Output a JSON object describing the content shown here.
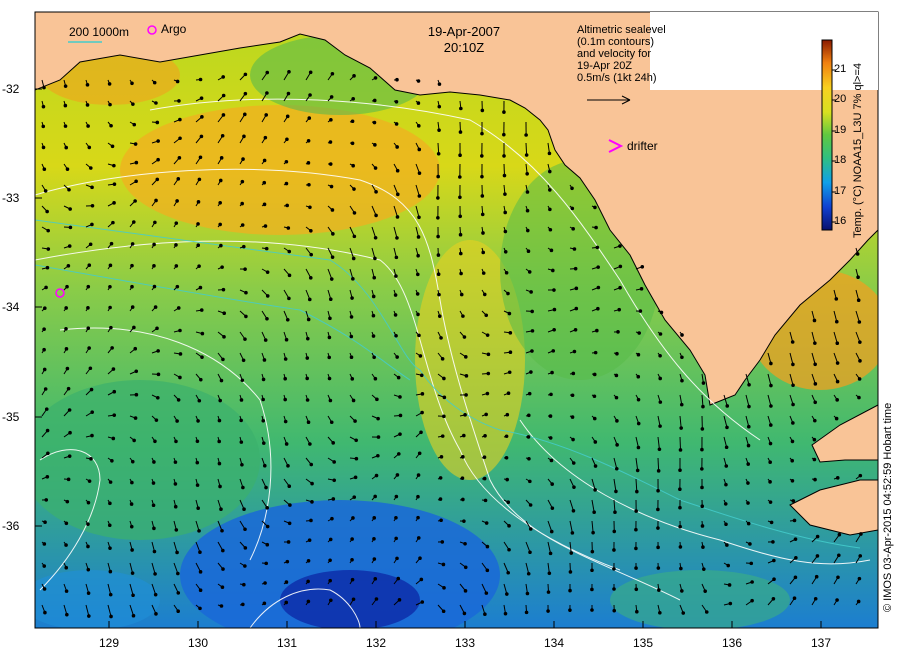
{
  "map": {
    "date": "19-Apr-2007",
    "time": "20:10Z",
    "scale_label": "200  1000m",
    "argo_label": "Argo",
    "drifter_label": "drifter",
    "legend_lines": [
      "Altimetric sealevel",
      "(0.1m contours)",
      "and velocity for",
      "19-Apr 20Z",
      "0.5m/s (1kt 24h)"
    ],
    "colorbar_title": "Temp. (°C) NOAA15_L3U 7% ql>=4",
    "colorbar_ticks": [
      "16",
      "17",
      "18",
      "19",
      "20",
      "21"
    ],
    "credit": "© IMOS 03-Apr-2015 04:52:59 Hobart time",
    "lat_ticks": [
      "-32",
      "-33",
      "-34",
      "-35",
      "-36"
    ],
    "lon_ticks": [
      "129",
      "130",
      "131",
      "132",
      "133",
      "134",
      "135",
      "136",
      "137"
    ],
    "colors": {
      "land": "#f9c497",
      "drifter": "#ff00ff",
      "argo": "#ff00ff",
      "contour": "#ffffff",
      "scale_bar": "#44cccc",
      "arrow": "#000000"
    }
  }
}
